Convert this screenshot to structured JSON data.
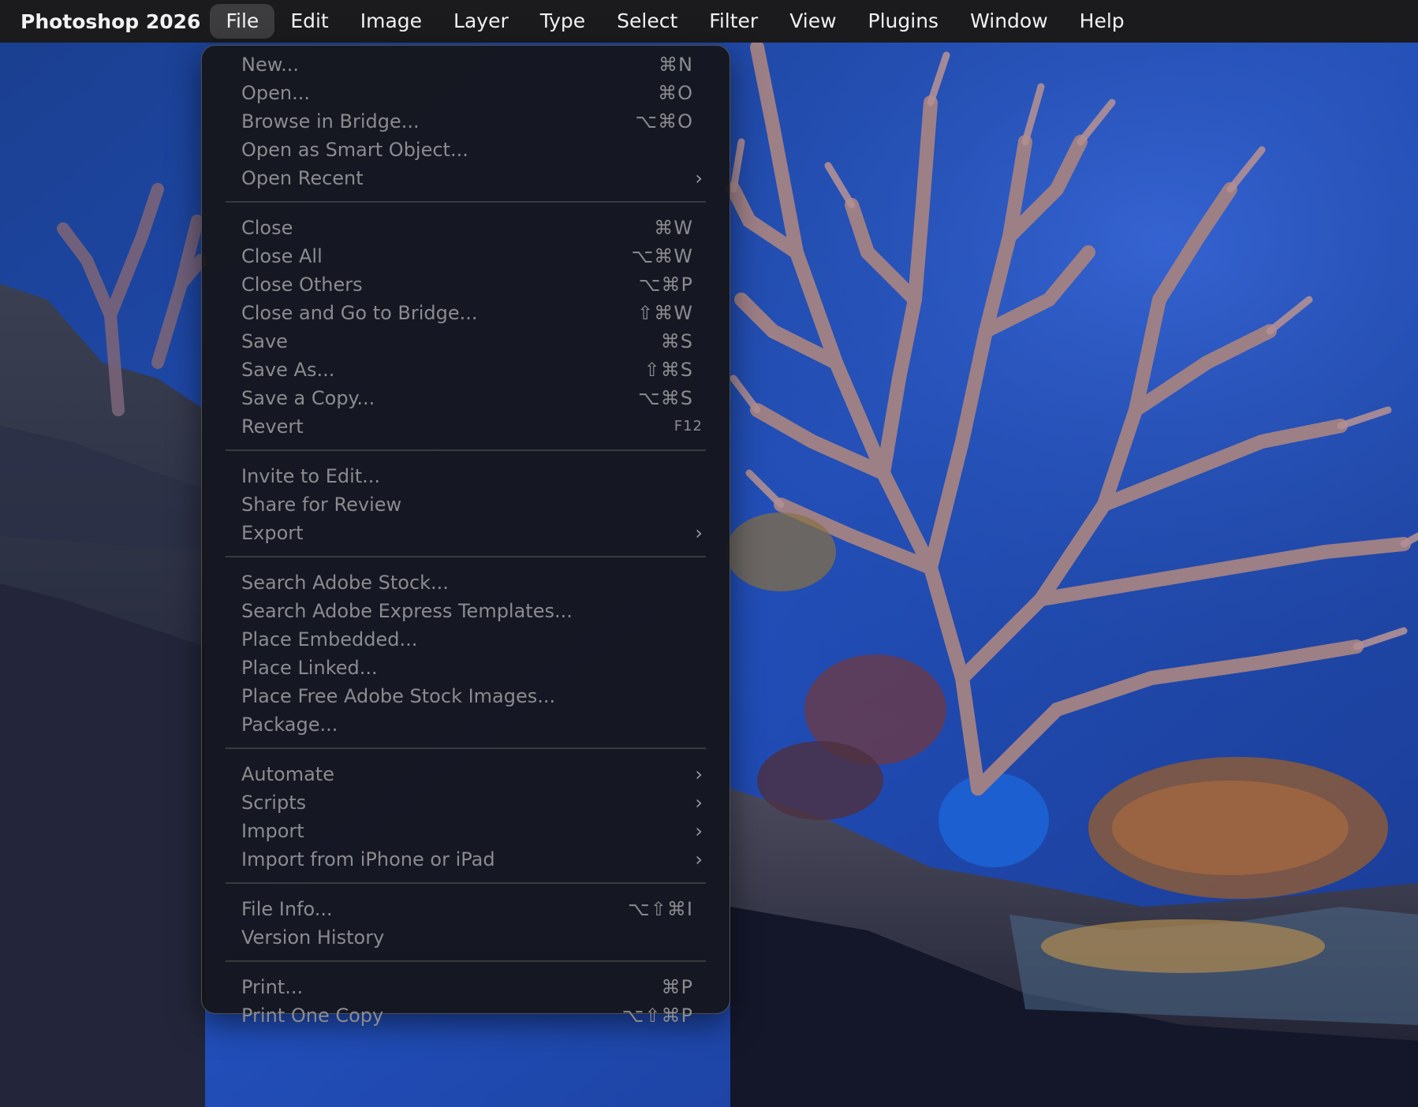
{
  "menubar": {
    "app_name": "Photoshop 2026",
    "items": [
      "File",
      "Edit",
      "Image",
      "Layer",
      "Type",
      "Select",
      "Filter",
      "View",
      "Plugins",
      "Window",
      "Help"
    ],
    "active": "File"
  },
  "file_menu": {
    "groups": [
      [
        {
          "label": "New...",
          "shortcut": "⌘N"
        },
        {
          "label": "Open...",
          "shortcut": "⌘O"
        },
        {
          "label": "Browse in Bridge...",
          "shortcut": "⌥⌘O"
        },
        {
          "label": "Open as Smart Object..."
        },
        {
          "label": "Open Recent",
          "submenu": true
        }
      ],
      [
        {
          "label": "Close",
          "shortcut": "⌘W"
        },
        {
          "label": "Close All",
          "shortcut": "⌥⌘W"
        },
        {
          "label": "Close Others",
          "shortcut": "⌥⌘P"
        },
        {
          "label": "Close and Go to Bridge...",
          "shortcut": "⇧⌘W"
        },
        {
          "label": "Save",
          "shortcut": "⌘S"
        },
        {
          "label": "Save As...",
          "shortcut": "⇧⌘S"
        },
        {
          "label": "Save a Copy...",
          "shortcut": "⌥⌘S"
        },
        {
          "label": "Revert",
          "shortcut": "F12"
        }
      ],
      [
        {
          "label": "Invite to Edit..."
        },
        {
          "label": "Share for Review"
        },
        {
          "label": "Export",
          "submenu": true
        }
      ],
      [
        {
          "label": "Search Adobe Stock..."
        },
        {
          "label": "Search Adobe Express Templates..."
        },
        {
          "label": "Place Embedded..."
        },
        {
          "label": "Place Linked..."
        },
        {
          "label": "Place Free Adobe Stock Images..."
        },
        {
          "label": "Package..."
        }
      ],
      [
        {
          "label": "Automate",
          "submenu": true
        },
        {
          "label": "Scripts",
          "submenu": true
        },
        {
          "label": "Import",
          "submenu": true
        },
        {
          "label": "Import from iPhone or iPad",
          "submenu": true
        }
      ],
      [
        {
          "label": "File Info...",
          "shortcut": "⌥⇧⌘I"
        },
        {
          "label": "Version History"
        }
      ],
      [
        {
          "label": "Print...",
          "shortcut": "⌘P"
        },
        {
          "label": "Print One Copy",
          "shortcut": "⌥⇧⌘P"
        }
      ]
    ]
  },
  "icons": {
    "submenu": "chevron-right-icon"
  },
  "colors": {
    "menubar_bg": "#1b1b1d",
    "menu_bg": "#141418",
    "disabled_text": "#8b8b8f",
    "water_blue": "#1f4fb8",
    "coral": "#9a7a82"
  }
}
